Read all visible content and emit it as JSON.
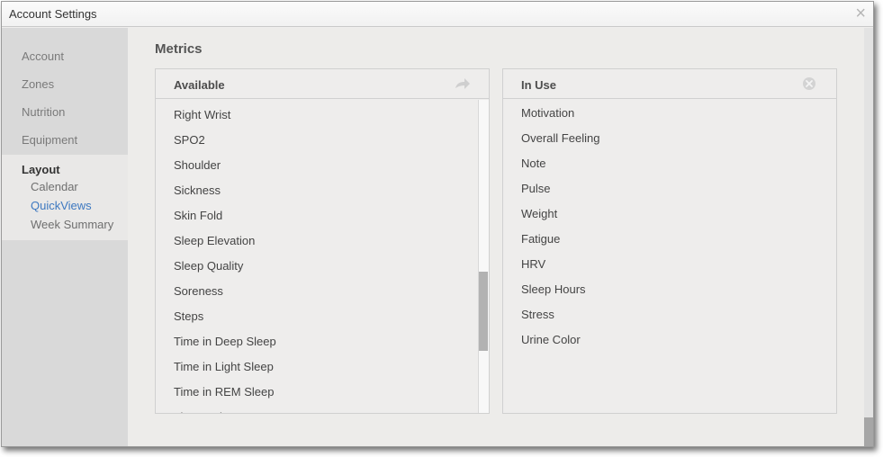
{
  "window": {
    "title": "Account Settings",
    "close_glyph": "×"
  },
  "sidebar": {
    "items": [
      {
        "label": "Account"
      },
      {
        "label": "Zones"
      },
      {
        "label": "Nutrition"
      },
      {
        "label": "Equipment"
      }
    ],
    "layout": {
      "label": "Layout",
      "subitems": [
        {
          "label": "Calendar"
        },
        {
          "label": "QuickViews"
        },
        {
          "label": "Week Summary"
        }
      ]
    }
  },
  "main": {
    "section_title": "Metrics",
    "available": {
      "title": "Available",
      "icon": "forward-arrow-icon",
      "items": [
        "Right Wrist",
        "SPO2",
        "Shoulder",
        "Sickness",
        "Skin Fold",
        "Sleep Elevation",
        "Sleep Quality",
        "Soreness",
        "Steps",
        "Time in Deep Sleep",
        "Time in Light Sleep",
        "Time in REM Sleep",
        "Time Wake"
      ],
      "scroll_fraction": 0.75
    },
    "in_use": {
      "title": "In Use",
      "icon": "clear-circle-icon",
      "items": [
        "Motivation",
        "Overall Feeling",
        "Note",
        "Pulse",
        "Weight",
        "Fatigue",
        "HRV",
        "Sleep Hours",
        "Stress",
        "Urine Color"
      ]
    }
  },
  "colors": {
    "active_link": "#3d78c0",
    "sidebar_bg": "#d9d9d9",
    "content_bg": "#edecea"
  }
}
